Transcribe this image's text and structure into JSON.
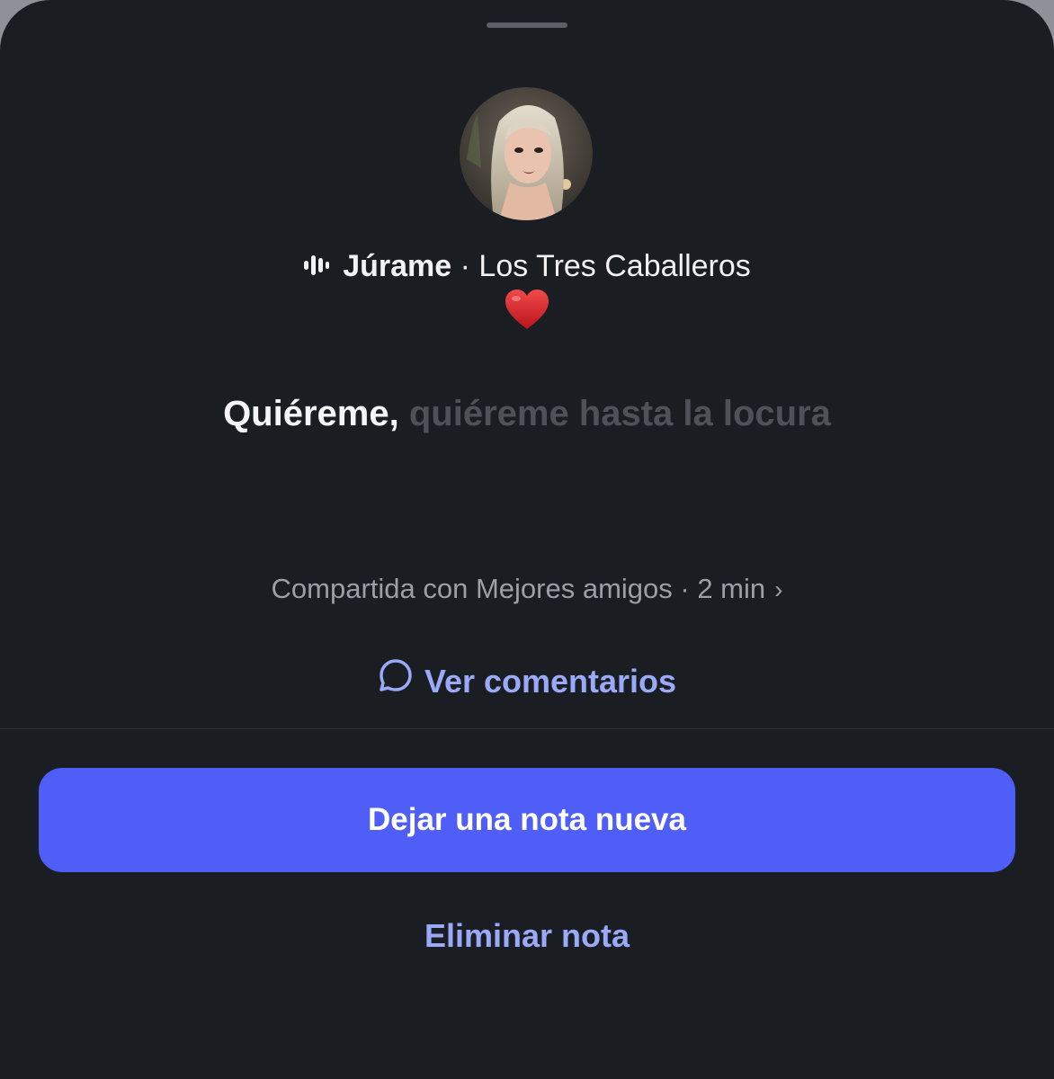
{
  "note": {
    "song_title": "Júrame",
    "separator": " · ",
    "artist": "Los Tres Caballeros",
    "emoji": "❤️",
    "lyric_active": "Quiéreme,",
    "lyric_upcoming": "quiéreme hasta la locura",
    "shared_text": "Compartida con Mejores amigos · 2 min",
    "chevron": "›"
  },
  "actions": {
    "comments_label": "Ver comentarios",
    "new_note_label": "Dejar una nota nueva",
    "delete_label": "Eliminar nota"
  },
  "icons": {
    "music": "music-bars-icon",
    "heart": "red-heart-icon",
    "comment": "comment-bubble-icon"
  },
  "colors": {
    "background": "#1a1d21",
    "accent": "#4e5ef7",
    "link": "#9aaaf8"
  }
}
